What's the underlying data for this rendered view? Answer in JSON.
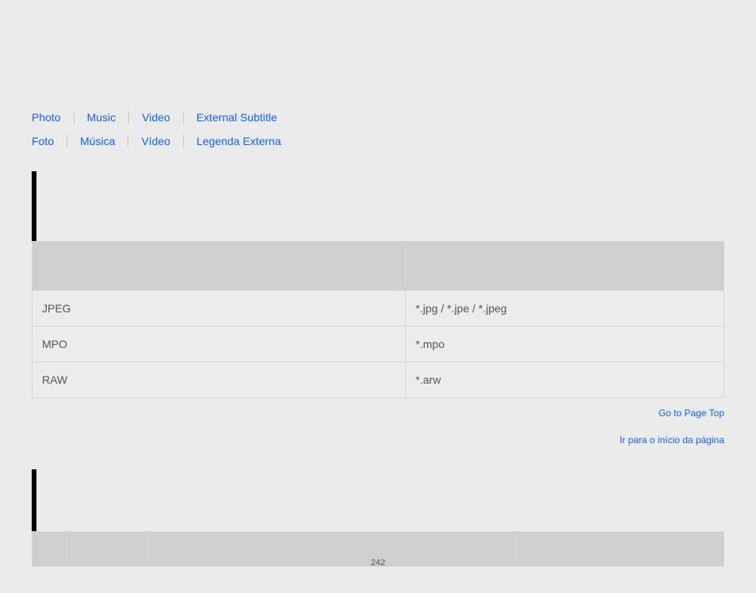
{
  "nav": {
    "en": [
      {
        "label": "Photo"
      },
      {
        "label": "Music"
      },
      {
        "label": "Video"
      },
      {
        "label": "External Subtitle"
      }
    ],
    "pt": [
      {
        "label": "Foto"
      },
      {
        "label": "Música"
      },
      {
        "label": "Vídeo"
      },
      {
        "label": "Legenda Externa"
      }
    ]
  },
  "table1": {
    "headers": [
      "",
      ""
    ],
    "rows": [
      {
        "a": "JPEG",
        "b": "*.jpg / *.jpe / *.jpeg"
      },
      {
        "a": "MPO",
        "b": "*.mpo"
      },
      {
        "a": "RAW",
        "b": "*.arw"
      }
    ]
  },
  "links": {
    "top_en": "Go to Page Top",
    "top_pt": "Ir para o início da página"
  },
  "table2": {
    "headers": [
      "",
      "",
      "",
      ""
    ]
  },
  "page_number": "242"
}
